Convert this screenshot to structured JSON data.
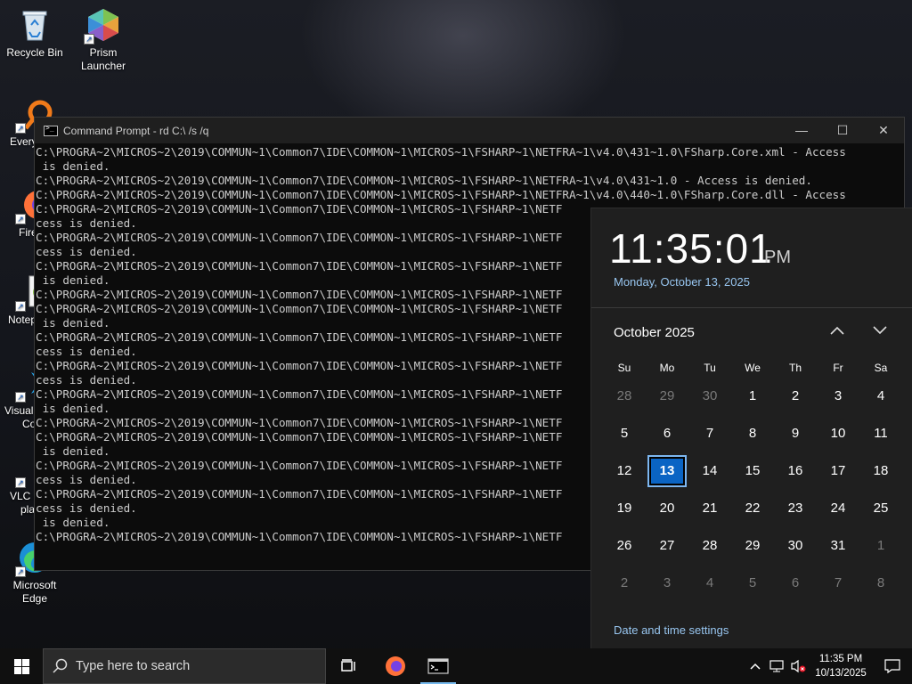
{
  "desktop": {
    "icons": [
      {
        "label": "Recycle Bin",
        "icon": "recycle-bin-icon"
      },
      {
        "label": "Prism Launcher",
        "icon": "prism-launcher-icon"
      },
      {
        "label": "Every",
        "icon": "everything-icon"
      },
      {
        "label": "Fire",
        "icon": "firefox-icon"
      },
      {
        "label": "Notep",
        "icon": "notepad-plus-icon"
      },
      {
        "label": "Visual",
        "label2": "Co",
        "icon": "vscode-icon"
      },
      {
        "label": "VLC r",
        "label2": "pla",
        "icon": "vlc-icon"
      },
      {
        "label": "Microsoft",
        "label2": "Edge",
        "icon": "edge-icon"
      }
    ]
  },
  "cmd": {
    "title": "Command Prompt - rd  C:\\ /s /q",
    "lines": [
      "C:\\PROGRA~2\\MICROS~2\\2019\\COMMUN~1\\Common7\\IDE\\COMMON~1\\MICROS~1\\FSHARP~1\\NETFRA~1\\v4.0\\431~1.0\\FSharp.Core.xml - Access",
      " is denied.",
      "C:\\PROGRA~2\\MICROS~2\\2019\\COMMUN~1\\Common7\\IDE\\COMMON~1\\MICROS~1\\FSHARP~1\\NETFRA~1\\v4.0\\431~1.0 - Access is denied.",
      "C:\\PROGRA~2\\MICROS~2\\2019\\COMMUN~1\\Common7\\IDE\\COMMON~1\\MICROS~1\\FSHARP~1\\NETFRA~1\\v4.0\\440~1.0\\FSharp.Core.dll - Access",
      "C:\\PROGRA~2\\MICROS~2\\2019\\COMMUN~1\\Common7\\IDE\\COMMON~1\\MICROS~1\\FSHARP~1\\NETF",
      "cess is denied.",
      "C:\\PROGRA~2\\MICROS~2\\2019\\COMMUN~1\\Common7\\IDE\\COMMON~1\\MICROS~1\\FSHARP~1\\NETF",
      "cess is denied.",
      "C:\\PROGRA~2\\MICROS~2\\2019\\COMMUN~1\\Common7\\IDE\\COMMON~1\\MICROS~1\\FSHARP~1\\NETF",
      " is denied.",
      "C:\\PROGRA~2\\MICROS~2\\2019\\COMMUN~1\\Common7\\IDE\\COMMON~1\\MICROS~1\\FSHARP~1\\NETF",
      "C:\\PROGRA~2\\MICROS~2\\2019\\COMMUN~1\\Common7\\IDE\\COMMON~1\\MICROS~1\\FSHARP~1\\NETF",
      " is denied.",
      "C:\\PROGRA~2\\MICROS~2\\2019\\COMMUN~1\\Common7\\IDE\\COMMON~1\\MICROS~1\\FSHARP~1\\NETF",
      "cess is denied.",
      "C:\\PROGRA~2\\MICROS~2\\2019\\COMMUN~1\\Common7\\IDE\\COMMON~1\\MICROS~1\\FSHARP~1\\NETF",
      "cess is denied.",
      "C:\\PROGRA~2\\MICROS~2\\2019\\COMMUN~1\\Common7\\IDE\\COMMON~1\\MICROS~1\\FSHARP~1\\NETF",
      " is denied.",
      "C:\\PROGRA~2\\MICROS~2\\2019\\COMMUN~1\\Common7\\IDE\\COMMON~1\\MICROS~1\\FSHARP~1\\NETF",
      "C:\\PROGRA~2\\MICROS~2\\2019\\COMMUN~1\\Common7\\IDE\\COMMON~1\\MICROS~1\\FSHARP~1\\NETF",
      " is denied.",
      "C:\\PROGRA~2\\MICROS~2\\2019\\COMMUN~1\\Common7\\IDE\\COMMON~1\\MICROS~1\\FSHARP~1\\NETF",
      "cess is denied.",
      "C:\\PROGRA~2\\MICROS~2\\2019\\COMMUN~1\\Common7\\IDE\\COMMON~1\\MICROS~1\\FSHARP~1\\NETF",
      "cess is denied.",
      " is denied.",
      "C:\\PROGRA~2\\MICROS~2\\2019\\COMMUN~1\\Common7\\IDE\\COMMON~1\\MICROS~1\\FSHARP~1\\NETF"
    ],
    "minimize": "—",
    "maximize": "☐",
    "close": "✕"
  },
  "calendar": {
    "time": "11:35:01",
    "ampm": "PM",
    "full_date": "Monday, October 13, 2025",
    "month_label": "October 2025",
    "weekdays": [
      "Su",
      "Mo",
      "Tu",
      "We",
      "Th",
      "Fr",
      "Sa"
    ],
    "days": [
      {
        "d": "28",
        "dim": true
      },
      {
        "d": "29",
        "dim": true
      },
      {
        "d": "30",
        "dim": true
      },
      {
        "d": "1"
      },
      {
        "d": "2"
      },
      {
        "d": "3"
      },
      {
        "d": "4"
      },
      {
        "d": "5"
      },
      {
        "d": "6"
      },
      {
        "d": "7"
      },
      {
        "d": "8"
      },
      {
        "d": "9"
      },
      {
        "d": "10"
      },
      {
        "d": "11"
      },
      {
        "d": "12"
      },
      {
        "d": "13",
        "today": true
      },
      {
        "d": "14"
      },
      {
        "d": "15"
      },
      {
        "d": "16"
      },
      {
        "d": "17"
      },
      {
        "d": "18"
      },
      {
        "d": "19"
      },
      {
        "d": "20"
      },
      {
        "d": "21"
      },
      {
        "d": "22"
      },
      {
        "d": "23"
      },
      {
        "d": "24"
      },
      {
        "d": "25"
      },
      {
        "d": "26"
      },
      {
        "d": "27"
      },
      {
        "d": "28"
      },
      {
        "d": "29"
      },
      {
        "d": "30"
      },
      {
        "d": "31"
      },
      {
        "d": "1",
        "dim": true
      },
      {
        "d": "2",
        "dim": true
      },
      {
        "d": "3",
        "dim": true
      },
      {
        "d": "4",
        "dim": true
      },
      {
        "d": "5",
        "dim": true
      },
      {
        "d": "6",
        "dim": true
      },
      {
        "d": "7",
        "dim": true
      },
      {
        "d": "8",
        "dim": true
      }
    ],
    "settings_link": "Date and time settings",
    "accent": "#0a64c4"
  },
  "taskbar": {
    "search_placeholder": "Type here to search",
    "clock_time": "11:35 PM",
    "clock_date": "10/13/2025"
  }
}
